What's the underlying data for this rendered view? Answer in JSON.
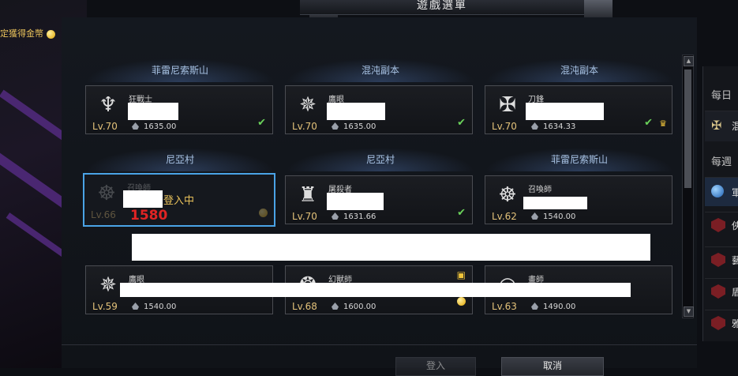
{
  "window": {
    "title": "遊戲選單"
  },
  "top_left_notice": "定獲得金幣",
  "servers": [
    "菲雷尼索斯山",
    "混沌副本",
    "混沌副本",
    "尼亞村",
    "尼亞村",
    "菲雷尼索斯山"
  ],
  "characters": [
    {
      "job": "狂戰士",
      "level": "Lv.70",
      "power": "1635.00",
      "icon": "berserker-emblem-icon"
    },
    {
      "job": "鷹眼",
      "level": "Lv.70",
      "power": "1635.00",
      "icon": "hawkeye-emblem-icon"
    },
    {
      "job": "刀鋒",
      "level": "Lv.70",
      "power": "1634.33",
      "icon": "blade-emblem-icon"
    },
    {
      "job": "召喚師",
      "level": "Lv.66",
      "power": "",
      "icon": "summoner-emblem-icon",
      "status": "登入中",
      "number": "1580"
    },
    {
      "job": "屠殺者",
      "level": "Lv.70",
      "power": "1631.66",
      "icon": "slayer-emblem-icon"
    },
    {
      "job": "召喚師",
      "level": "Lv.62",
      "power": "1540.00",
      "icon": "summoner-emblem-icon"
    },
    {
      "job": "鷹眼",
      "level": "Lv.59",
      "power": "1540.00",
      "icon": "hawkeye-emblem-icon"
    },
    {
      "job": "幻獸師",
      "level": "Lv.68",
      "power": "1600.00",
      "icon": "beastmaster-emblem-icon"
    },
    {
      "job": "畫師",
      "level": "Lv.63",
      "power": "1490.00",
      "icon": "artist-emblem-icon"
    }
  ],
  "right_panel": {
    "daily": "每日",
    "weekly": "每週",
    "row_text": [
      "混",
      "軍",
      "俠",
      "藝",
      "盾",
      "雅"
    ]
  },
  "footer": {
    "confirm": "登入",
    "cancel": "取消"
  },
  "colors": {
    "accent": "#4aa3e6",
    "gold": "#e7c05a",
    "check": "#6ad15a",
    "alert": "#e02424"
  }
}
